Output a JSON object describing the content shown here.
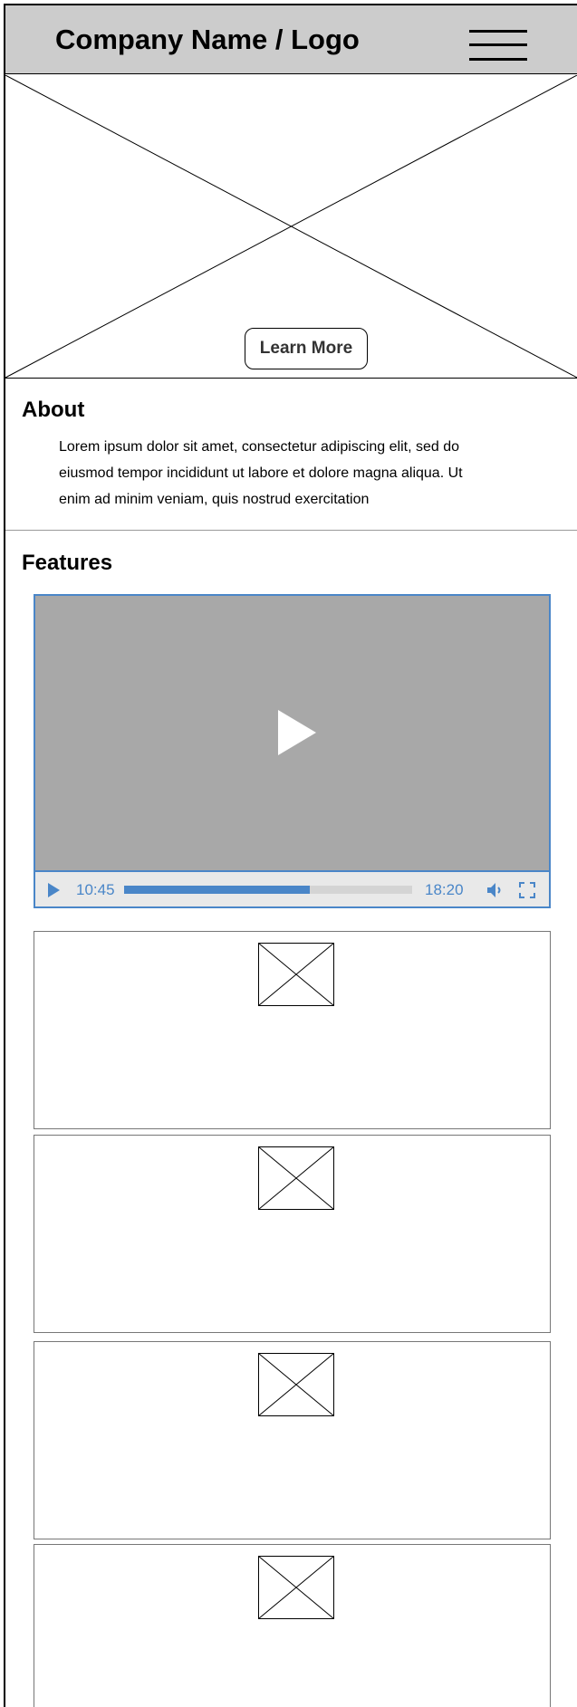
{
  "header": {
    "logo": "Company Name / Logo",
    "menu_icon": "hamburger-icon"
  },
  "hero": {
    "button_label": "Learn More",
    "image_icon": "image-placeholder-icon"
  },
  "about": {
    "title": "About",
    "lines": [
      "Lorem ipsum dolor sit amet, consectetur adipiscing elit, sed do",
      "eiusmod tempor incididunt ut labore et dolore magna aliqua. Ut",
      "enim ad minim veniam, quis nostrud exercitation"
    ]
  },
  "features": {
    "title": "Features",
    "video": {
      "current_time": "10:45",
      "duration": "18:20",
      "progress": 0.645,
      "play_icon": "play-icon",
      "volume_icon": "volume-icon",
      "fullscreen_icon": "fullscreen-icon"
    },
    "cards": [
      {
        "icon": "image-placeholder-icon"
      },
      {
        "icon": "image-placeholder-icon"
      },
      {
        "icon": "image-placeholder-icon"
      },
      {
        "icon": "image-placeholder-icon"
      }
    ]
  },
  "colors": {
    "header_bg": "#cccccc",
    "accent": "#4a86c8",
    "video_bg": "#a8a8a8"
  }
}
